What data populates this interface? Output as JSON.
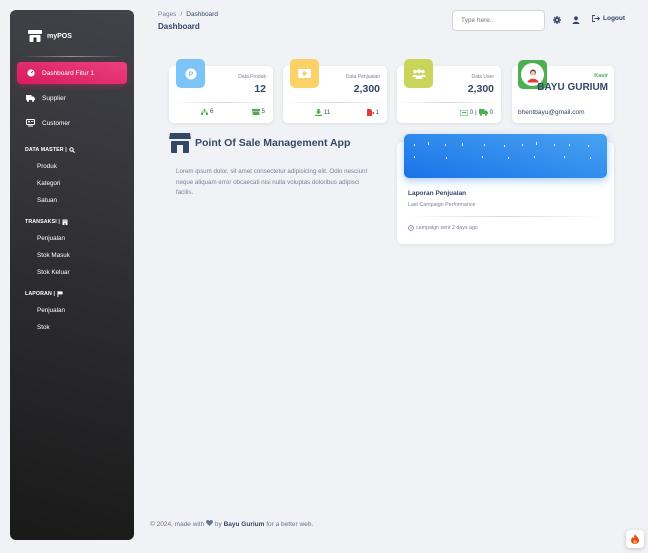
{
  "brand": {
    "name": "myPOS",
    "icon": "store-icon"
  },
  "sidebar": {
    "items": [
      {
        "label": "Dashboard Fitur 1",
        "icon": "dashboard-icon",
        "active": true
      },
      {
        "label": "Supplier",
        "icon": "truck-icon"
      },
      {
        "label": "Customer",
        "icon": "customers-icon"
      }
    ],
    "sections": [
      {
        "title": "DATA MASTER |",
        "icon": "search-icon",
        "items": [
          "Produk",
          "Kategori",
          "Satuan"
        ]
      },
      {
        "title": "TRANSAKSI |",
        "icon": "building-icon",
        "items": [
          "Penjualan",
          "Stok Masuk",
          "Stok Keluar"
        ]
      },
      {
        "title": "LAPORAN |",
        "icon": "flag-icon",
        "items": [
          "Penjualan",
          "Stok"
        ]
      }
    ]
  },
  "header": {
    "breadcrumb": {
      "root": "Pages",
      "separator": "/",
      "current": "Dashboard"
    },
    "title": "Dashboard",
    "search_placeholder": "Type here..",
    "logout": "Logout"
  },
  "stats": [
    {
      "label": "Data Produk",
      "value": "12",
      "badge_color": "#7cc4f8",
      "icon": "parking-icon",
      "foot_left": {
        "icon": "sitemap-icon",
        "value": "6",
        "color": "#4caf50"
      },
      "foot_right": {
        "icon": "box-icon",
        "value": "5",
        "color": "#4caf50"
      }
    },
    {
      "label": "Data Penjualan",
      "value": "2,300",
      "badge_color": "#fbd168",
      "icon": "money-icon",
      "foot_left": {
        "icon": "download-icon",
        "value": "11",
        "color": "#4caf50"
      },
      "foot_right": {
        "icon": "file-export-icon",
        "value": "1",
        "color": "#e53935"
      }
    },
    {
      "label": "Data User",
      "value": "2,300",
      "badge_color": "#c8d45a",
      "icon": "users-icon",
      "foot_left": {
        "icon": "cash-register-icon",
        "value": "0",
        "color": "#4caf50"
      },
      "foot_right": {
        "icon": "truck-icon",
        "value": "0",
        "color": "#4caf50"
      }
    }
  ],
  "profile": {
    "role": "Kasir",
    "name": "BAYU GURIUM",
    "email": "bhentbayu@gmail.com",
    "role_color": "#4caf50"
  },
  "intro": {
    "title": "Point Of Sale Management App",
    "text": "Lorem ipsum dolor, sit amet consectetur adipisicing elit. Odio nesciunt neque aliquam error obcaecati nisi nulla voluptas doloribus adipisci facilis."
  },
  "report": {
    "title": "Laporan Penjualan",
    "subtitle": "Last Campaign Performance",
    "footer": "campaign sent 2 days ago",
    "chart_color": "#1a73e8"
  },
  "footer": {
    "prefix": "© 2024, made with",
    "by": "by",
    "author": "Bayu Gurium",
    "suffix": "for a better web."
  }
}
